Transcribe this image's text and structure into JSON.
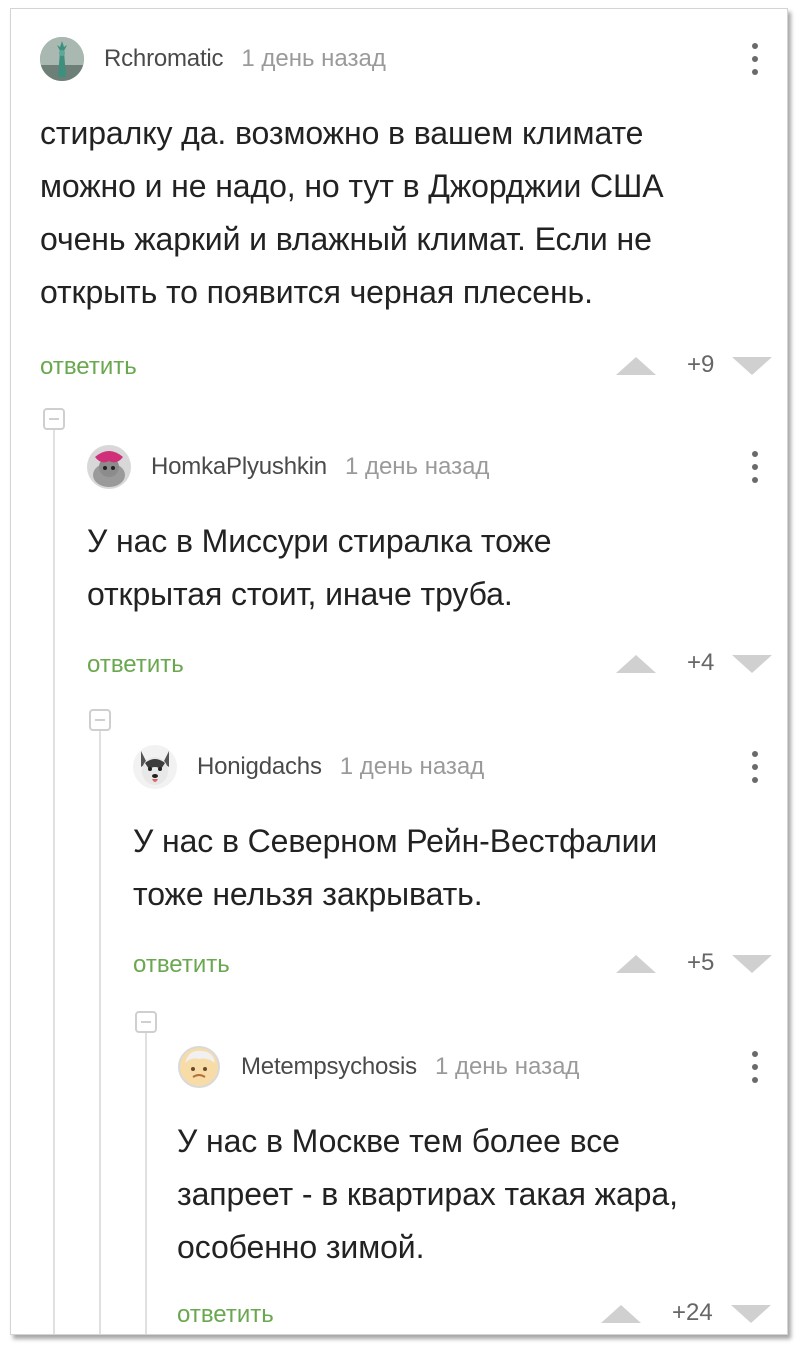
{
  "reply_label": "ответить",
  "comments": [
    {
      "author": "Rchromatic",
      "time": "1 день назад",
      "lines": [
        "стиралку да. возможно в вашем климате",
        "можно и не надо, но тут в Джорджии США",
        "очень жаркий и влажный климат. Если не",
        "открыть то появится черная плесень."
      ],
      "score": "+9"
    },
    {
      "author": "HomkaPlyushkin",
      "time": "1 день назад",
      "lines": [
        "У нас в Миссури стиралка тоже",
        "открытая стоит, иначе труба."
      ],
      "score": "+4"
    },
    {
      "author": "Honigdachs",
      "time": "1 день назад",
      "lines": [
        "У нас в Северном Рейн-Вестфалии",
        "тоже нельзя закрывать."
      ],
      "score": "+5"
    },
    {
      "author": "Metempsychosis",
      "time": "1 день назад",
      "lines": [
        "У нас в Москве тем более все",
        "запреет - в квартирах такая жара,",
        "особенно зимой."
      ],
      "score": "+24"
    }
  ],
  "colors": {
    "reply": "#6aa84f",
    "author": "#4a4a4a",
    "time": "#9a9a9a",
    "vote_arrow": "#d0d0d0"
  }
}
